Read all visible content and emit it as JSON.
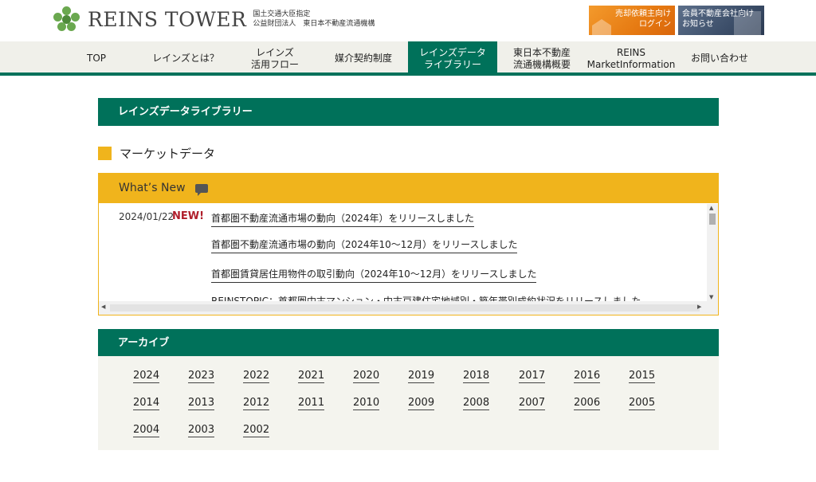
{
  "header": {
    "site_name": "REINS TOWER",
    "sub_line1": "国土交通大臣指定",
    "sub_line2": "公益財団法人　東日本不動産流通機構",
    "sell_btn_line1": "売却依頼主向け",
    "sell_btn_line2": "ログイン",
    "member_btn_line1": "会員不動産会社向け",
    "member_btn_line2": "お知らせ"
  },
  "nav": {
    "items": [
      {
        "line1": "TOP",
        "line2": ""
      },
      {
        "line1": "レインズとは？",
        "line2": ""
      },
      {
        "line1": "レインズ",
        "line2": "活用フロー"
      },
      {
        "line1": "媒介契約制度",
        "line2": ""
      },
      {
        "line1": "レインズデータ",
        "line2": "ライブラリー"
      },
      {
        "line1": "東日本不動産",
        "line2": "流通機構概要"
      },
      {
        "line1": "REINS",
        "line2": "MarketInformation"
      },
      {
        "line1": "お問い合わせ",
        "line2": ""
      }
    ]
  },
  "main": {
    "page_heading": "レインズデータライブラリー",
    "section_title": "マーケットデータ",
    "whats_new": "What’s New",
    "news": {
      "date": "2024/01/22",
      "badge": "NEW!",
      "items": [
        "首都圏不動産流通市場の動向（2024年）をリリースしました",
        "首都圏不動産流通市場の動向（2024年10～12月）をリリースしました",
        "首都圏賃貸居住用物件の取引動向（2024年10～12月）をリリースしました",
        "REINSTOPIC：首都圏中古マンション・中古戸建住宅地域別・築年帯別成約状況をリリースしました"
      ]
    },
    "archive_heading": "アーカイブ",
    "years": [
      "2024",
      "2023",
      "2022",
      "2021",
      "2020",
      "2019",
      "2018",
      "2017",
      "2016",
      "2015",
      "2014",
      "2013",
      "2012",
      "2011",
      "2010",
      "2009",
      "2008",
      "2007",
      "2006",
      "2005",
      "2004",
      "2003",
      "2002"
    ]
  },
  "colors": {
    "brand_green": "#00715a",
    "accent_yellow": "#f0b41c",
    "new_red": "#b01e2b"
  }
}
